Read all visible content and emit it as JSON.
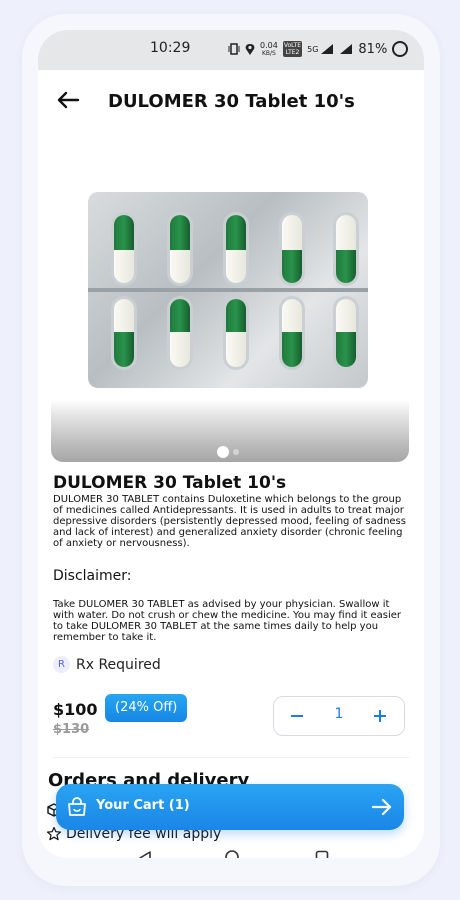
{
  "status_bar": {
    "time": "10:29",
    "speed_value": "0.04",
    "speed_unit": "KB/S",
    "network_top": "VoLTE",
    "network_bottom": "LTE2",
    "signal_label": "5G",
    "battery": "81%"
  },
  "header": {
    "title": "DULOMER 30 Tablet 10's"
  },
  "carousel": {
    "total_slides": 2,
    "active_slide": 1
  },
  "product": {
    "name": "DULOMER 30 Tablet 10's",
    "description": "DULOMER 30 TABLET contains Duloxetine which belongs to the group of medicines called Antidepressants. It is used in adults to treat major depressive disorders (persistently depressed mood, feeling of sadness and lack of interest) and generalized anxiety disorder (chronic feeling of anxiety or nervousness).",
    "disclaimer_title": "Disclaimer:",
    "disclaimer_text": "Take DULOMER 30 TABLET as advised by your physician. Swallow it with water. Do not crush or chew the medicine. You may find it easier to take DULOMER 30 TABLET at the same times daily to help you remember to take it.",
    "rx_symbol": "R",
    "rx_label": "Rx Required",
    "price": "$100",
    "discount": "(24% Off)",
    "old_price": "$130",
    "quantity": "1"
  },
  "orders": {
    "title": "Orders and delivery",
    "delivery_fee": "Delivery fee will apply"
  },
  "cart": {
    "label": "Your Cart (1)"
  },
  "colors": {
    "accent": "#1a86e6",
    "badge": "#26a6f2",
    "status_bar": "#e6e7e8"
  },
  "icons": [
    "back-arrow-icon",
    "shopping-bag-icon",
    "arrow-right-icon",
    "box-icon",
    "star-icon",
    "nav-back-icon",
    "nav-home-icon",
    "nav-recent-icon"
  ]
}
